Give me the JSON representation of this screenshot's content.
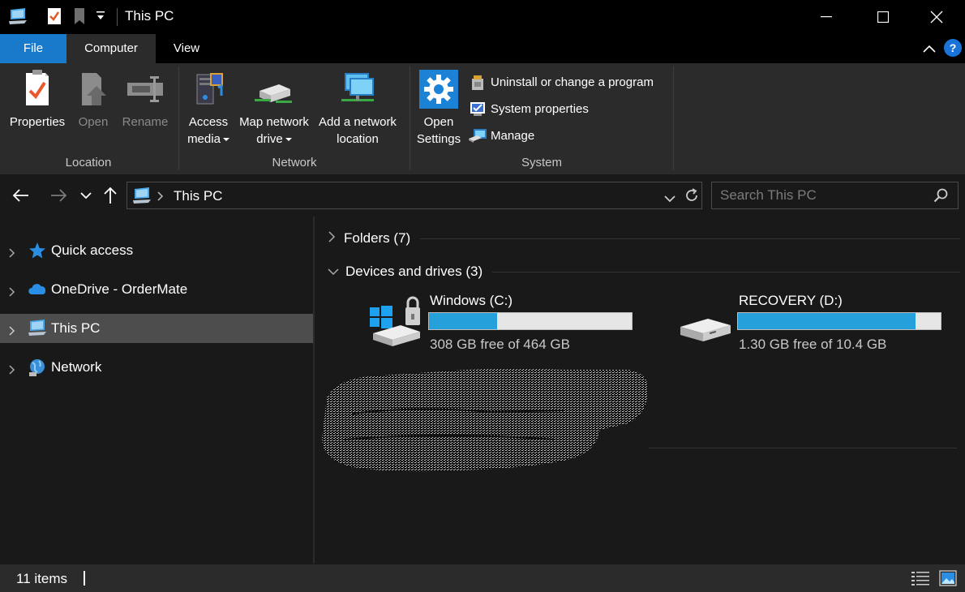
{
  "window": {
    "title": "This PC",
    "controls": {
      "minimize": "—",
      "maximize": "☐",
      "close": "✕"
    }
  },
  "ribbon_tabs": [
    {
      "label": "File"
    },
    {
      "label": "Computer"
    },
    {
      "label": "View"
    }
  ],
  "help_label": "?",
  "ribbon": {
    "location": {
      "label": "Location",
      "buttons": [
        {
          "label": "Properties",
          "icon": "properties-icon"
        },
        {
          "label": "Open",
          "icon": "open-icon"
        },
        {
          "label": "Rename",
          "icon": "rename-icon"
        }
      ]
    },
    "network": {
      "label": "Network",
      "buttons": [
        {
          "label_line1": "Access",
          "label_line2": "media",
          "icon": "access-media-icon"
        },
        {
          "label_line1": "Map network",
          "label_line2": "drive",
          "icon": "map-network-drive-icon"
        },
        {
          "label_line1": "Add a network",
          "label_line2": "location",
          "icon": "add-network-location-icon"
        }
      ]
    },
    "system": {
      "label": "System",
      "open_settings_line1": "Open",
      "open_settings_line2": "Settings",
      "items": [
        {
          "label": "Uninstall or change a program",
          "icon": "uninstall-icon"
        },
        {
          "label": "System properties",
          "icon": "system-properties-icon"
        },
        {
          "label": "Manage",
          "icon": "manage-icon"
        }
      ]
    }
  },
  "address": {
    "path": "This PC",
    "search_placeholder": "Search This PC"
  },
  "sidebar": {
    "items": [
      {
        "label": "Quick access",
        "icon": "star-icon"
      },
      {
        "label": "OneDrive - OrderMate",
        "icon": "onedrive-icon"
      },
      {
        "label": "This PC",
        "icon": "this-pc-icon",
        "selected": true
      },
      {
        "label": "Network",
        "icon": "network-icon"
      }
    ]
  },
  "content": {
    "folders_section": "Folders (7)",
    "devices_section": "Devices and drives (3)",
    "drives": [
      {
        "name": "Windows (C:)",
        "free_text": "308 GB free of 464 GB",
        "used_fraction": 0.336,
        "icon": "windows-drive-icon"
      },
      {
        "name": "RECOVERY (D:)",
        "free_text": "1.30 GB free of 10.4 GB",
        "used_fraction": 0.875,
        "icon": "drive-icon"
      }
    ]
  },
  "status": {
    "items_count": "11 items"
  },
  "colors": {
    "accent": "#1979ca",
    "drive_fill": "#26a0da",
    "selected_bg": "#4d4d4d"
  }
}
